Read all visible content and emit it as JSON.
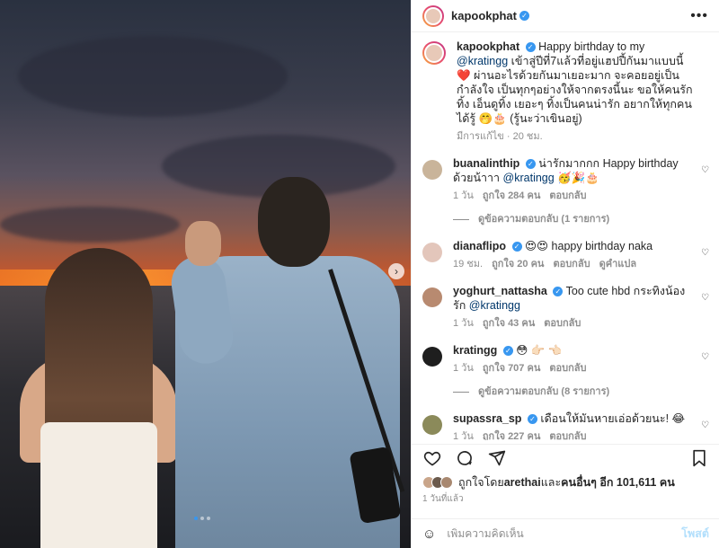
{
  "post": {
    "username": "kapookphat",
    "more_icon": "more-icon",
    "photo_alt_icon": "next-arrow-icon",
    "carousel": {
      "count": 3,
      "active": 0
    }
  },
  "caption": {
    "username": "kapookphat",
    "text_pre": "Happy birthday to my ",
    "mention": "@kratingg",
    "text_post": " เข้าสู่ปีที่7แล้วที่อยู่แฮปปี้กันมาแบบนี้ ❤️ ผ่านอะไรด้วยกันมาเยอะมาก จะคอยอยู่เป็นกำลังใจ เป็นทุกๆอย่างให้จากตรงนี้นะ ขอให้คนรักทิ้ง เอ็นดูทิ้ง เยอะๆ ทิ้งเป็นคนน่ารัก อยากให้ทุกคนได้รู้ 🤭🎂 (รู้นะว่าเขินอยู่)",
    "meta": "มีการแก้ไข · 20 ชม."
  },
  "comments": [
    {
      "username": "buanalinthip",
      "verified": true,
      "text": "น่ารักมากกก Happy birthday ด้วยน้าาา ",
      "mention": "@kratingg",
      "tail": " 🥳🎉🎂",
      "time": "1 วัน",
      "likes": "ถูกใจ 284 คน",
      "reply": "ตอบกลับ",
      "translate": "",
      "replies": "ดูข้อความตอบกลับ (1 รายการ)",
      "avatar_color": "#c9b49a"
    },
    {
      "username": "dianaflipo",
      "verified": true,
      "text": "😍😍 happy birthday naka",
      "mention": "",
      "tail": "",
      "time": "19 ชม.",
      "likes": "ถูกใจ 20 คน",
      "reply": "ตอบกลับ",
      "translate": "ดูคำแปล",
      "replies": "",
      "avatar_color": "#e3c6bb"
    },
    {
      "username": "yoghurt_nattasha",
      "verified": true,
      "text": "Too cute hbd กระทิงน้องรัก ",
      "mention": "@kratingg",
      "tail": "",
      "time": "1 วัน",
      "likes": "ถูกใจ 43 คน",
      "reply": "ตอบกลับ",
      "translate": "",
      "replies": "",
      "avatar_color": "#b88a70"
    },
    {
      "username": "kratingg",
      "verified": true,
      "text": "😳 👉🏻 👈🏻",
      "mention": "",
      "tail": "",
      "time": "1 วัน",
      "likes": "ถูกใจ 707 คน",
      "reply": "ตอบกลับ",
      "translate": "",
      "replies": "ดูข้อความตอบกลับ (8 รายการ)",
      "avatar_color": "#1e1e1e"
    },
    {
      "username": "supassra_sp",
      "verified": true,
      "text": "เดือนให้มันหายเอ่อด้วยนะ! 😂",
      "mention": "",
      "tail": "",
      "time": "1 วัน",
      "likes": "ถูกใจ 227 คน",
      "reply": "ตอบกลับ",
      "translate": "",
      "replies": "ดูข้อความตอบกลับ (3 รายการ)",
      "avatar_color": "#8b8a5a"
    }
  ],
  "likes": {
    "text_pre": "ถูกใจโดย ",
    "user": "arethai",
    "text_mid": " และ",
    "others": "คนอื่นๆ อีก 101,611 คน"
  },
  "time_ago": "1 วันที่แล้ว",
  "add_comment": {
    "placeholder": "เพิ่มความคิดเห็น",
    "post_label": "โพสต์"
  }
}
